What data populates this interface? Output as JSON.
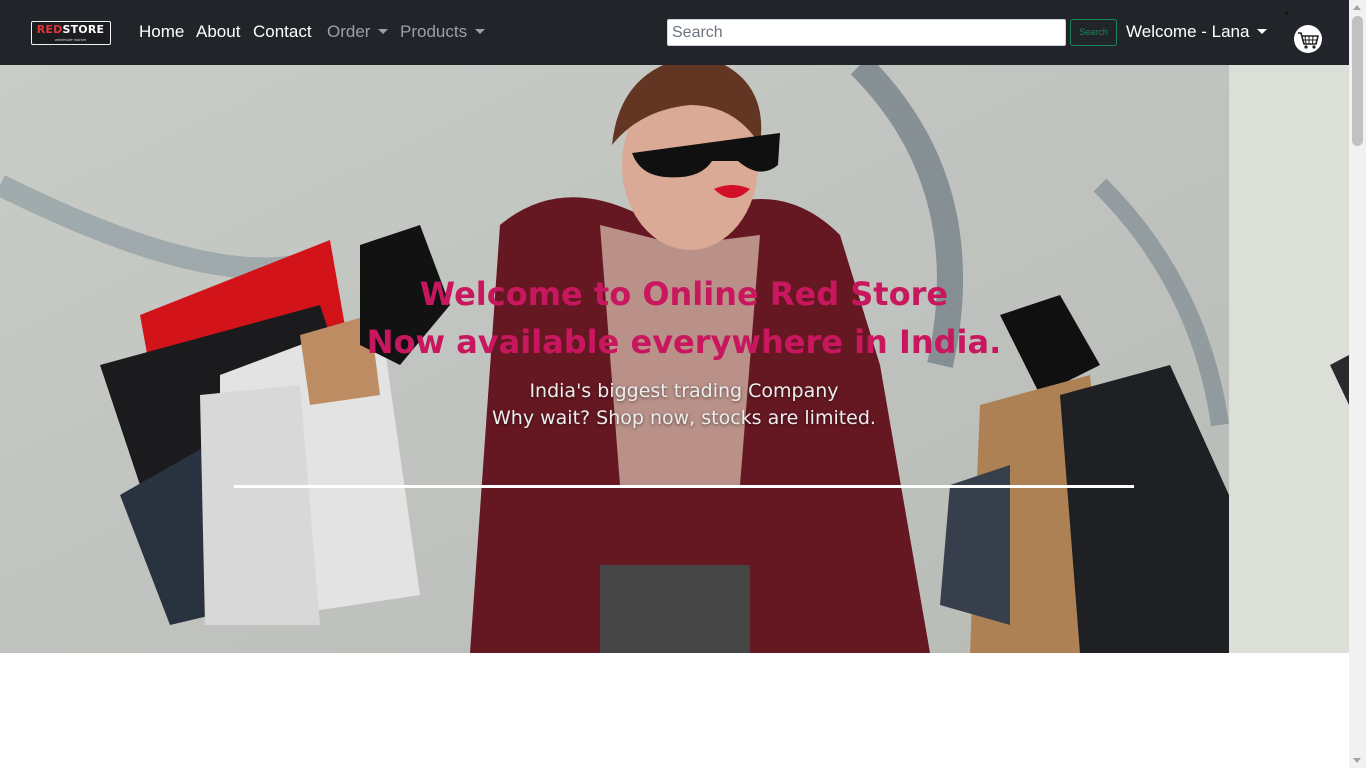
{
  "logo": {
    "word_red": "RED",
    "word_white": "STORE",
    "tagline": "wholesale market"
  },
  "nav": {
    "home": "Home",
    "about": "About",
    "contact": "Contact",
    "order": "Order",
    "products": "Products"
  },
  "search": {
    "placeholder": "Search",
    "button": "Search"
  },
  "user": {
    "greeting": "Welcome - Lana"
  },
  "icons": {
    "cart": "shopping-cart-icon",
    "dropdown": "caret-down-icon"
  },
  "hero": {
    "title_line1": "Welcome to Online Red Store",
    "title_line2": "Now available everywhere in India.",
    "sub_line1": "India's biggest trading Company",
    "sub_line2": "Why wait? Shop now, stocks are limited."
  },
  "colors": {
    "navbar": "#212529",
    "headline": "#c9175f",
    "search_button": "#198754",
    "logo_red": "#e2333b"
  }
}
